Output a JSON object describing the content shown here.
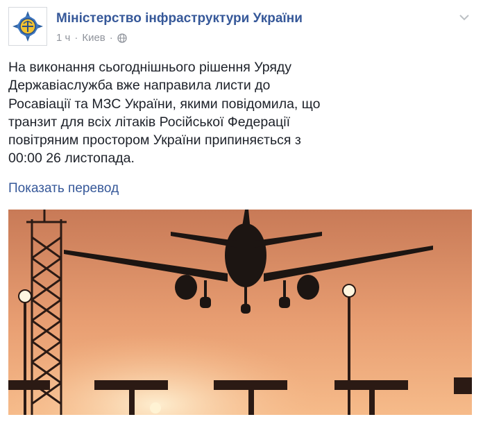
{
  "post": {
    "page_name": "Міністерство інфраструктури України",
    "time": "1 ч",
    "separator": "·",
    "location": "Киев",
    "privacy_icon": "globe-icon",
    "menu_icon": "chevron-down-icon",
    "text": "На виконання сьогоднішнього рішення Уряду\nДержавіаслужба вже направила листи до\nРосавіації та МЗС України, якими повідомила, що\nтранзит для всіх літаків Російської Федерації\nповітряним простором України припиняється з\n00:00 26 листопада.",
    "translate_link": "Показать перевод",
    "photo_subject": "airplane-landing-sunset"
  },
  "colors": {
    "link": "#365899",
    "text": "#1d2129",
    "meta": "#90949c",
    "sky_top": "#c87a57",
    "sky_bottom": "#f5b888"
  }
}
